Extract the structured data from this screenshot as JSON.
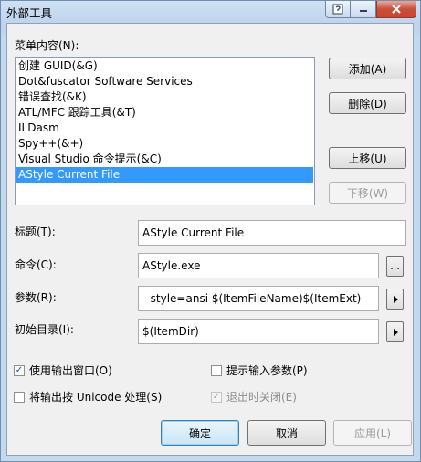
{
  "window": {
    "title": "外部工具"
  },
  "menu_contents": {
    "label": "菜单内容(N):",
    "items": [
      "创建 GUID(&G)",
      "Dot&fuscator Software Services",
      "错误查找(&K)",
      "ATL/MFC 跟踪工具(&T)",
      "ILDasm",
      "Spy++(&+)",
      "Visual Studio 命令提示(&C)",
      "AStyle Current File"
    ],
    "selected_index": 7
  },
  "side_buttons": {
    "add": "添加(A)",
    "delete": "删除(D)",
    "move_up": "上移(U)",
    "move_down": "下移(W)"
  },
  "fields": {
    "title_label": "标题(T):",
    "title_value": "AStyle Current File",
    "command_label": "命令(C):",
    "command_value": "AStyle.exe",
    "browse_label": "...",
    "args_label": "参数(R):",
    "args_value": "--style=ansi $(ItemFileName)$(ItemExt)",
    "initdir_label": "初始目录(I):",
    "initdir_value": "$(ItemDir)"
  },
  "checkboxes": {
    "use_output": {
      "label": "使用输出窗口(O)",
      "checked": true
    },
    "prompt_args": {
      "label": "提示输入参数(P)",
      "checked": false
    },
    "unicode": {
      "label": "将输出按 Unicode 处理(S)",
      "checked": false
    },
    "close_on_exit": {
      "label": "退出时关闭(E)",
      "checked": true,
      "disabled": true
    }
  },
  "footer": {
    "ok": "确定",
    "cancel": "取消",
    "apply": "应用(L)"
  },
  "colors": {
    "selection": "#3399ff",
    "dialog_bg": "#f0f0f0",
    "close_button": "#c7503a"
  }
}
